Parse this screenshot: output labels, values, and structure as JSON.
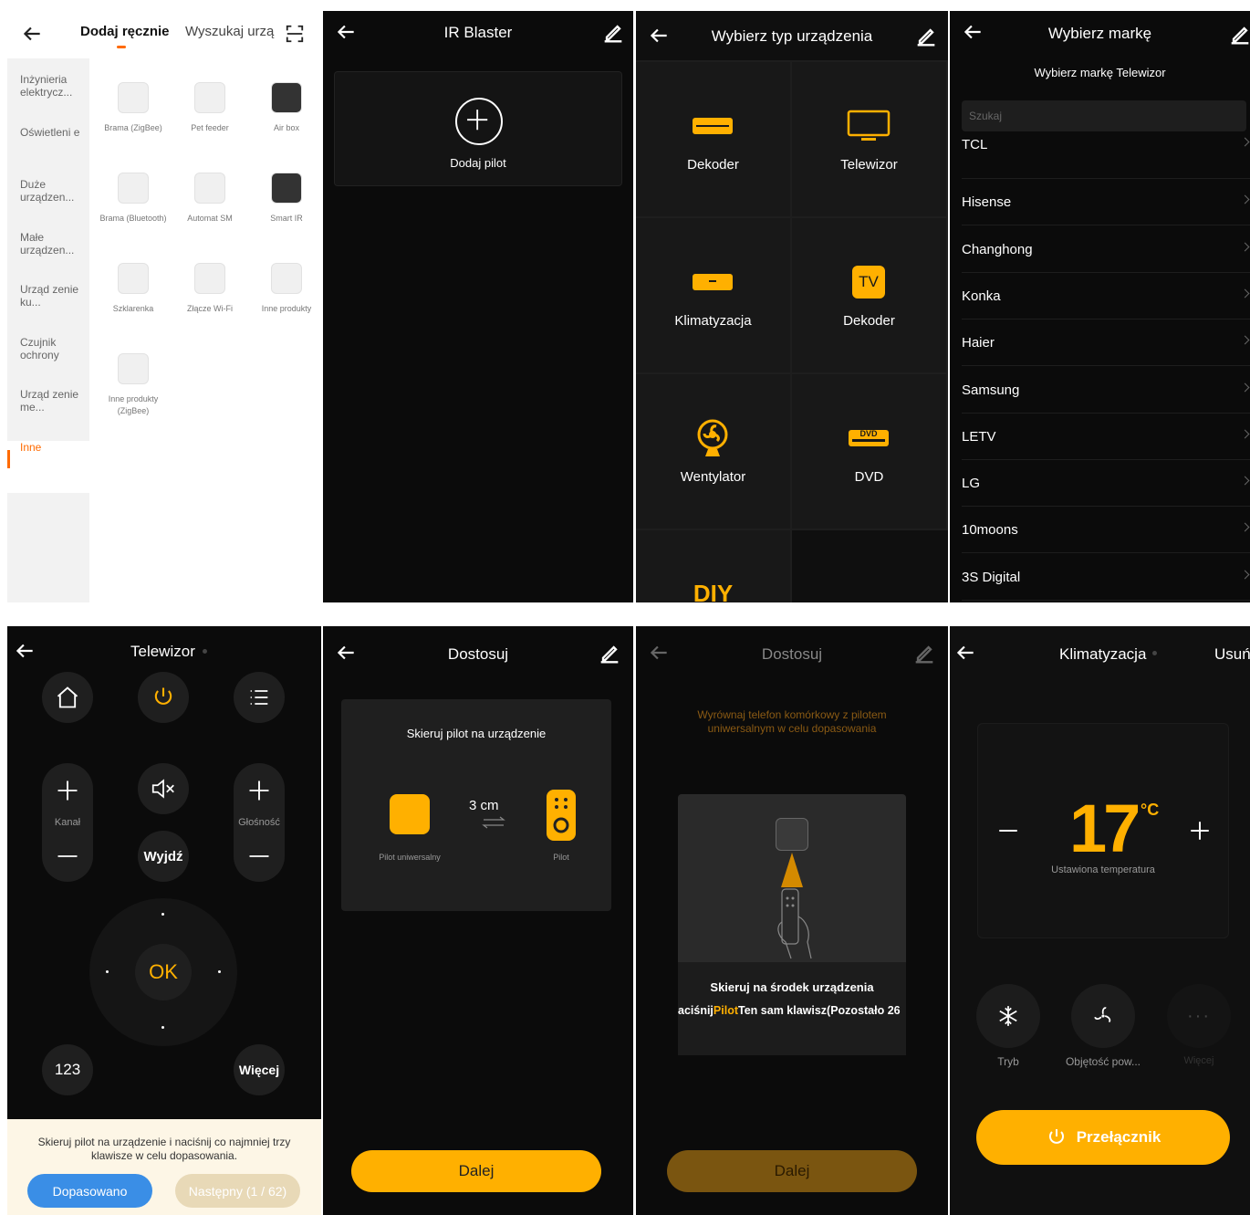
{
  "p1": {
    "tabs": [
      "Dodaj ręcznie",
      "Wyszukaj urzą"
    ],
    "sidebar": [
      "Inżynieria elektrycz...",
      "Oświetleni e",
      "Duże urządzen...",
      "Małe urządzen...",
      "Urząd zenie ku...",
      "Czujnik ochrony",
      "Urząd zenie me...",
      "Inne"
    ],
    "products": [
      {
        "label": "Brama (ZigBee)",
        "icon": "zigbee-gateway-icon"
      },
      {
        "label": "Pet feeder",
        "icon": "pet-feeder-icon"
      },
      {
        "label": "Air box",
        "icon": "air-box-icon"
      },
      {
        "label": "Brama (Bluetooth)",
        "icon": "bluetooth-gateway-icon"
      },
      {
        "label": "Automat SM",
        "icon": "robot-icon"
      },
      {
        "label": "Smart IR",
        "icon": "smart-ir-icon"
      },
      {
        "label": "Szklarenka",
        "icon": "greenhouse-icon"
      },
      {
        "label": "Złącze Wi-Fi",
        "icon": "wifi-plug-icon"
      },
      {
        "label": "Inne produkty",
        "icon": "other-products-icon"
      },
      {
        "label": "Inne produkty (ZigBee)",
        "icon": "other-zigbee-icon"
      }
    ]
  },
  "p2": {
    "title": "IR Blaster",
    "add_label": "Dodaj pilot"
  },
  "p3": {
    "title": "Wybierz typ urządzenia",
    "devices": [
      "Dekoder",
      "Telewizor",
      "Klimatyzacja",
      "Dekoder",
      "Wentylator",
      "DVD"
    ],
    "tv_badge": "TV",
    "dvd_badge": "DVD",
    "diy": "DIY"
  },
  "p4": {
    "title": "Wybierz markę",
    "subtitle": "Wybierz markę Telewizor",
    "search_placeholder": "Szukaj",
    "brands": [
      "TCL",
      "Hisense",
      "Changhong",
      "Konka",
      "Haier",
      "Samsung",
      "LETV",
      "LG",
      "10moons",
      "3S Digital"
    ]
  },
  "p5": {
    "title": "Telewizor",
    "kanal": "Kanał",
    "glosnosc": "Głośność",
    "wyjdz": "Wyjdź",
    "ok": "OK",
    "num": "123",
    "wiecej": "Więcej",
    "hint": "Skieruj pilot na urządzenie i naciśnij co najmniej trzy klawisze w celu dopasowania.",
    "match_btn": "Dopasowano",
    "next_btn": "Następny (1 / 62)"
  },
  "p6": {
    "title": "Dostosuj",
    "card_title": "Skieruj pilot na urządzenie",
    "distance": "3 cm",
    "left_label": "Pilot uniwersalny",
    "right_label": "Pilot",
    "next": "Dalej"
  },
  "p7": {
    "title": "Dostosuj",
    "hint": "Wyrównaj telefon komórkowy z pilotem uniwersalnym w celu dopasowania",
    "card_title": "Skieruj na środek urządzenia",
    "line_a": "aciśnij",
    "line_b": "Pilot",
    "line_c": "Ten sam klawisz(Pozostało 26",
    "next": "Dalej"
  },
  "p8": {
    "title": "Klimatyzacja",
    "action": "Usuń",
    "temp": "17",
    "unit": "°C",
    "temp_label": "Ustawiona temperatura",
    "modes": [
      "Tryb",
      "Objętość pow...",
      "Więcej"
    ],
    "power": "Przełącznik"
  },
  "colors": {
    "accent": "#ffb000",
    "orange": "#f5a623",
    "blue": "#3a8ee6"
  }
}
